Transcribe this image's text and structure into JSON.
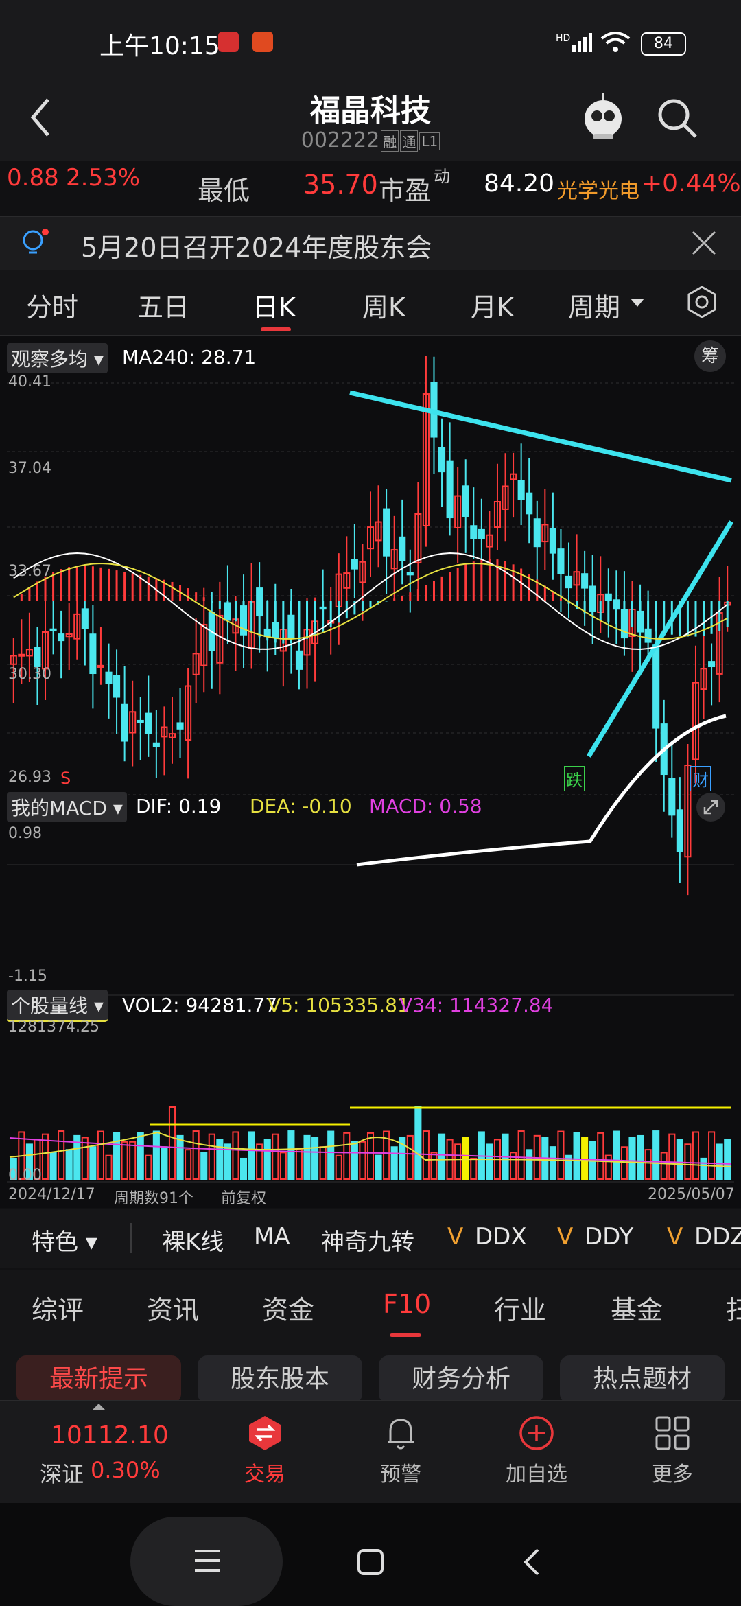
{
  "status": {
    "time": "上午10:15",
    "battery": "84"
  },
  "header": {
    "title": "福晶科技",
    "code": "002222",
    "tags": [
      "融",
      "通",
      "L1"
    ]
  },
  "quote": {
    "change": "0.88",
    "change_pct": "2.53%",
    "low_label": "最低",
    "low_value": "35.70",
    "pe_label": "市盈",
    "pe_sup": "动",
    "pe_value": "84.20",
    "sector_name": "光学光电",
    "sector_pct": "+0.44%"
  },
  "notice": {
    "text": "5月20日召开2024年度股东会"
  },
  "period_tabs": [
    "分时",
    "五日",
    "日K",
    "周K",
    "月K",
    "周期"
  ],
  "kline": {
    "indicator_dropdown": "观察多均",
    "ma240": "MA240: 28.71",
    "chip_btn": "筹",
    "y_labels": [
      "40.41",
      "37.04",
      "33.67",
      "30.30",
      "26.93"
    ],
    "marker_s": "S",
    "marker_die": "跌",
    "marker_cai": "财"
  },
  "macd": {
    "dropdown": "我的MACD",
    "dif": "DIF: 0.19",
    "dea": "DEA: -0.10",
    "macd": "MACD: 0.58",
    "y_top": "0.98",
    "y_bottom": "-1.15"
  },
  "volume": {
    "dropdown": "个股量线",
    "vol2": "VOL2: 94281.77",
    "v5": "V5: 105335.81",
    "v34": "V34: 114327.84",
    "y_top": "1281374.25",
    "y_bottom": "0.00",
    "date_start": "2024/12/17",
    "period_count": "周期数91个",
    "adjust": "前复权",
    "date_end": "2025/05/07"
  },
  "features": {
    "dropdown": "特色",
    "items": [
      "裸K线",
      "MA",
      "神奇九转",
      "DDX",
      "DDY",
      "DDZ"
    ]
  },
  "content_tabs": [
    "综评",
    "资讯",
    "资金",
    "F10",
    "行业",
    "基金",
    "扫"
  ],
  "chips": [
    "最新提示",
    "股东股本",
    "财务分析",
    "热点题材"
  ],
  "bottom_nav": {
    "index_value": "10112.10",
    "index_name": "深证",
    "index_pct": "0.30%",
    "items": [
      "交易",
      "预警",
      "加自选",
      "更多"
    ]
  },
  "chart_data": {
    "type": "candlestick",
    "ylim": [
      26.93,
      40.41
    ],
    "x_start": "2024/12/17",
    "x_end": "2025/05/07",
    "trendline_labels": []
  },
  "colors": {
    "up": "#ff3b3b",
    "down": "#4be6ee",
    "accent": "#e8373b",
    "ma_white": "#ffffff",
    "ma_yellow": "#e6e040"
  }
}
